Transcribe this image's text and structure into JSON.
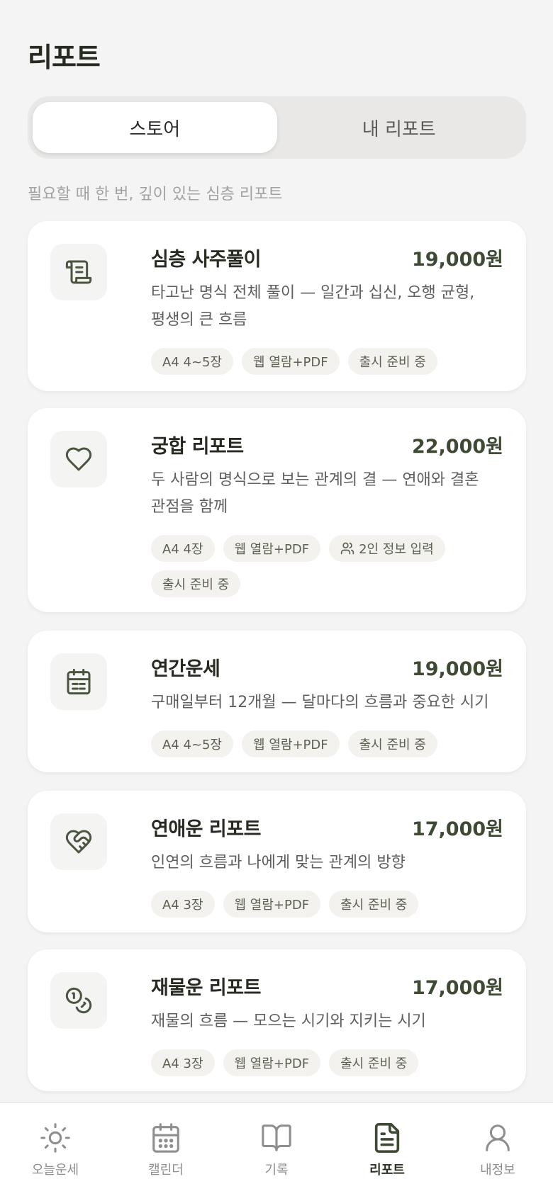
{
  "header": {
    "title": "리포트"
  },
  "segmented": {
    "store": "스토어",
    "my_reports": "내 리포트",
    "active": "store"
  },
  "subtitle": "필요할 때 한 번, 깊이 있는 심층 리포트",
  "cards": [
    {
      "icon": "scroll-icon",
      "title": "심층 사주풀이",
      "price": "19,000원",
      "desc": "타고난 명식 전체 풀이 — 일간과 십신, 오행 균형, 평생의 큰 흐름",
      "chips": [
        "A4 4~5장",
        "웹 열람+PDF",
        "출시 준비 중"
      ]
    },
    {
      "icon": "heart-icon",
      "title": "궁합 리포트",
      "price": "22,000원",
      "desc": "두 사람의 명식으로 보는 관계의 결 — 연애와 결혼 관점을 함께",
      "chips": [
        "A4 4장",
        "웹 열람+PDF",
        "2인 정보 입력",
        "출시 준비 중"
      ]
    },
    {
      "icon": "calendar-icon",
      "title": "연간운세",
      "price": "19,000원",
      "desc": "구매일부터 12개월 — 달마다의 흐름과 중요한 시기",
      "chips": [
        "A4 4~5장",
        "웹 열람+PDF",
        "출시 준비 중"
      ]
    },
    {
      "icon": "heart-handshake-icon",
      "title": "연애운 리포트",
      "price": "17,000원",
      "desc": "인연의 흐름과 나에게 맞는 관계의 방향",
      "chips": [
        "A4 3장",
        "웹 열람+PDF",
        "출시 준비 중"
      ]
    },
    {
      "icon": "coins-icon",
      "title": "재물운 리포트",
      "price": "17,000원",
      "desc": "재물의 흐름 — 모으는 시기와 지키는 시기",
      "chips": [
        "A4 3장",
        "웹 열람+PDF",
        "출시 준비 중"
      ]
    }
  ],
  "tabbar": [
    {
      "label": "오늘운세",
      "icon": "sun-icon",
      "active": false
    },
    {
      "label": "캘린더",
      "icon": "calendar-icon",
      "active": false
    },
    {
      "label": "기록",
      "icon": "book-icon",
      "active": false
    },
    {
      "label": "리포트",
      "icon": "document-icon",
      "active": true
    },
    {
      "label": "내정보",
      "icon": "user-icon",
      "active": false
    }
  ],
  "colors": {
    "accent": "#3f4a35",
    "background": "#f4f4f4",
    "chip": "#f3f2ef"
  }
}
